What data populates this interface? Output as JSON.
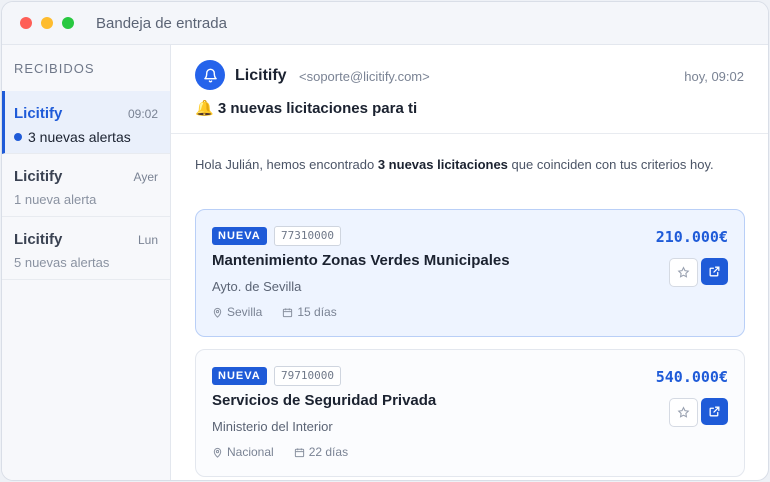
{
  "window": {
    "title": "Bandeja de entrada"
  },
  "sidebar": {
    "heading": "RECIBIDOS",
    "items": [
      {
        "name": "Licitify",
        "time": "09:02",
        "summary": "3 nuevas alertas",
        "active": true
      },
      {
        "name": "Licitify",
        "time": "Ayer",
        "summary": "1 nueva alerta",
        "active": false
      },
      {
        "name": "Licitify",
        "time": "Lun",
        "summary": "5 nuevas alertas",
        "active": false
      }
    ]
  },
  "message": {
    "from_name": "Licitify",
    "from_email": "<soporte@licitify.com>",
    "time": "hoy, 09:02",
    "subject_emoji": "🔔",
    "subject": "3 nuevas licitaciones para ti",
    "intro_before": "Hola Julián, hemos encontrado ",
    "intro_bold": "3 nuevas licitaciones",
    "intro_after": " que coinciden con tus criterios hoy."
  },
  "cards": [
    {
      "badge": "NUEVA",
      "code": "77310000",
      "price": "210.000€",
      "title": "Mantenimiento Zonas Verdes Municipales",
      "org": "Ayto. de Sevilla",
      "location": "Sevilla",
      "days": "15 días"
    },
    {
      "badge": "NUEVA",
      "code": "79710000",
      "price": "540.000€",
      "title": "Servicios de Seguridad Privada",
      "org": "Ministerio del Interior",
      "location": "Nacional",
      "days": "22 días"
    }
  ],
  "colors": {
    "accent": "#1f5bd8",
    "highlight_bg": "#eef4ff"
  }
}
